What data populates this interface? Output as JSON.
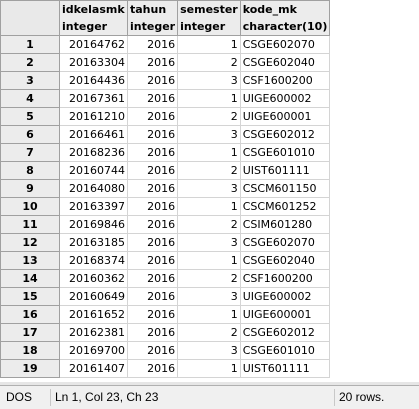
{
  "columns": [
    {
      "name": "idkelasmk",
      "type": "integer"
    },
    {
      "name": "tahun",
      "type": "integer"
    },
    {
      "name": "semester",
      "type": "integer"
    },
    {
      "name": "kode_mk",
      "type": "character(10)"
    }
  ],
  "rows": [
    {
      "n": "1",
      "id": "20164762",
      "tahun": "2016",
      "sem": "1",
      "kode": "CSGE602070"
    },
    {
      "n": "2",
      "id": "20163304",
      "tahun": "2016",
      "sem": "2",
      "kode": "CSGE602040"
    },
    {
      "n": "3",
      "id": "20164436",
      "tahun": "2016",
      "sem": "3",
      "kode": "CSF1600200"
    },
    {
      "n": "4",
      "id": "20167361",
      "tahun": "2016",
      "sem": "1",
      "kode": "UIGE600002"
    },
    {
      "n": "5",
      "id": "20161210",
      "tahun": "2016",
      "sem": "2",
      "kode": "UIGE600001"
    },
    {
      "n": "6",
      "id": "20166461",
      "tahun": "2016",
      "sem": "3",
      "kode": "CSGE602012"
    },
    {
      "n": "7",
      "id": "20168236",
      "tahun": "2016",
      "sem": "1",
      "kode": "CSGE601010"
    },
    {
      "n": "8",
      "id": "20160744",
      "tahun": "2016",
      "sem": "2",
      "kode": "UIST601111"
    },
    {
      "n": "9",
      "id": "20164080",
      "tahun": "2016",
      "sem": "3",
      "kode": "CSCM601150"
    },
    {
      "n": "10",
      "id": "20163397",
      "tahun": "2016",
      "sem": "1",
      "kode": "CSCM601252"
    },
    {
      "n": "11",
      "id": "20169846",
      "tahun": "2016",
      "sem": "2",
      "kode": "CSIM601280"
    },
    {
      "n": "12",
      "id": "20163185",
      "tahun": "2016",
      "sem": "3",
      "kode": "CSGE602070"
    },
    {
      "n": "13",
      "id": "20168374",
      "tahun": "2016",
      "sem": "1",
      "kode": "CSGE602040"
    },
    {
      "n": "14",
      "id": "20160362",
      "tahun": "2016",
      "sem": "2",
      "kode": "CSF1600200"
    },
    {
      "n": "15",
      "id": "20160649",
      "tahun": "2016",
      "sem": "3",
      "kode": "UIGE600002"
    },
    {
      "n": "16",
      "id": "20161652",
      "tahun": "2016",
      "sem": "1",
      "kode": "UIGE600001"
    },
    {
      "n": "17",
      "id": "20162381",
      "tahun": "2016",
      "sem": "2",
      "kode": "CSGE602012"
    },
    {
      "n": "18",
      "id": "20169700",
      "tahun": "2016",
      "sem": "3",
      "kode": "CSGE601010"
    },
    {
      "n": "19",
      "id": "20161407",
      "tahun": "2016",
      "sem": "1",
      "kode": "UIST601111"
    }
  ],
  "status": {
    "encoding": "DOS",
    "position": "Ln 1, Col 23, Ch 23",
    "rows": "20 rows."
  }
}
